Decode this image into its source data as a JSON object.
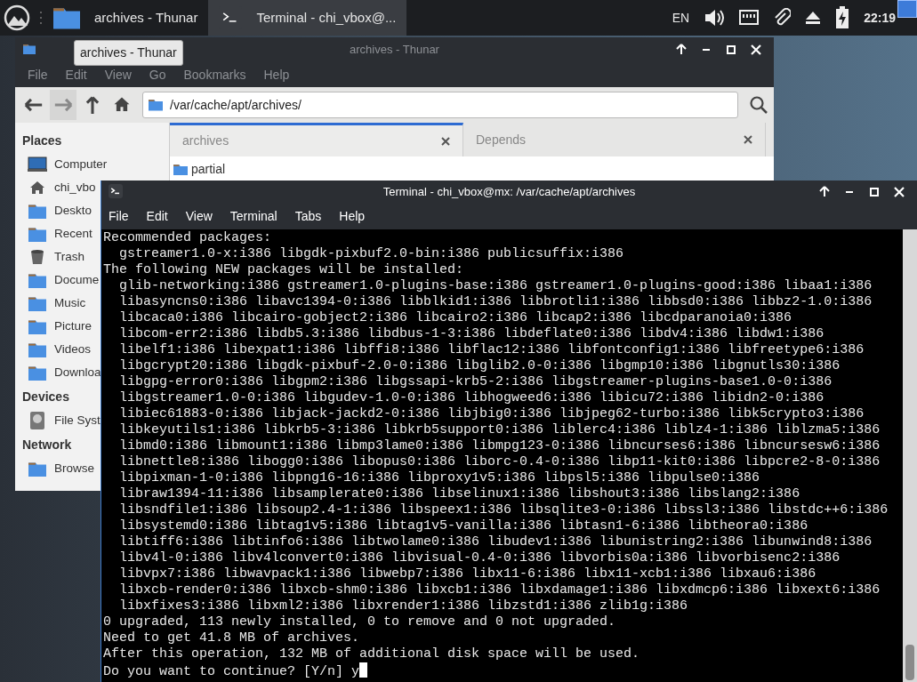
{
  "taskbar": {
    "tasks": [
      {
        "kind": "folder",
        "label": "archives - Thunar",
        "selected": false
      },
      {
        "kind": "terminal",
        "label": "Terminal - chi_vbox@...",
        "selected": true
      }
    ],
    "keyboard_layout": "EN",
    "clock": "22:19"
  },
  "file_manager": {
    "title": "archives - Thunar",
    "tooltip": "archives - Thunar",
    "menu": [
      "File",
      "Edit",
      "View",
      "Go",
      "Bookmarks",
      "Help"
    ],
    "nav": [
      {
        "kind": "back",
        "disabled": false
      },
      {
        "kind": "forward",
        "disabled": true
      },
      {
        "kind": "up",
        "disabled": false
      },
      {
        "kind": "home",
        "disabled": false
      }
    ],
    "location": "/var/cache/apt/archives/",
    "sidebar": [
      {
        "heading": "Places",
        "items": [
          {
            "kind": "computer",
            "label": "Computer"
          },
          {
            "kind": "home",
            "label": "chi_vbo"
          },
          {
            "kind": "folder",
            "label": "Deskto"
          },
          {
            "kind": "folder",
            "label": "Recent"
          },
          {
            "kind": "trash",
            "label": "Trash"
          },
          {
            "kind": "folder",
            "label": "Docume"
          },
          {
            "kind": "folder",
            "label": "Music"
          },
          {
            "kind": "folder",
            "label": "Picture"
          },
          {
            "kind": "folder",
            "label": "Videos"
          },
          {
            "kind": "folder",
            "label": "Downloa"
          }
        ]
      },
      {
        "heading": "Devices",
        "items": [
          {
            "kind": "drive",
            "label": "File Syst"
          }
        ]
      },
      {
        "heading": "Network",
        "items": [
          {
            "kind": "folder",
            "label": "Browse"
          }
        ]
      }
    ],
    "tabs": [
      {
        "label": "archives",
        "selected": true
      },
      {
        "label": "Depends",
        "selected": false
      }
    ],
    "files": [
      "partial"
    ]
  },
  "terminal": {
    "title": "Terminal - chi_vbox@mx: /var/cache/apt/archives",
    "menu": [
      "File",
      "Edit",
      "View",
      "Terminal",
      "Tabs",
      "Help"
    ],
    "lines": [
      "Recommended packages:",
      "  gstreamer1.0-x:i386 libgdk-pixbuf2.0-bin:i386 publicsuffix:i386",
      "The following NEW packages will be installed:",
      "  glib-networking:i386 gstreamer1.0-plugins-base:i386 gstreamer1.0-plugins-good:i386 libaa1:i386",
      "  libasyncns0:i386 libavc1394-0:i386 libblkid1:i386 libbrotli1:i386 libbsd0:i386 libbz2-1.0:i386",
      "  libcaca0:i386 libcairo-gobject2:i386 libcairo2:i386 libcap2:i386 libcdparanoia0:i386",
      "  libcom-err2:i386 libdb5.3:i386 libdbus-1-3:i386 libdeflate0:i386 libdv4:i386 libdw1:i386",
      "  libelf1:i386 libexpat1:i386 libffi8:i386 libflac12:i386 libfontconfig1:i386 libfreetype6:i386",
      "  libgcrypt20:i386 libgdk-pixbuf-2.0-0:i386 libglib2.0-0:i386 libgmp10:i386 libgnutls30:i386",
      "  libgpg-error0:i386 libgpm2:i386 libgssapi-krb5-2:i386 libgstreamer-plugins-base1.0-0:i386",
      "  libgstreamer1.0-0:i386 libgudev-1.0-0:i386 libhogweed6:i386 libicu72:i386 libidn2-0:i386",
      "  libiec61883-0:i386 libjack-jackd2-0:i386 libjbig0:i386 libjpeg62-turbo:i386 libk5crypto3:i386",
      "  libkeyutils1:i386 libkrb5-3:i386 libkrb5support0:i386 liblerc4:i386 liblz4-1:i386 liblzma5:i386",
      "  libmd0:i386 libmount1:i386 libmp3lame0:i386 libmpg123-0:i386 libncurses6:i386 libncursesw6:i386",
      "  libnettle8:i386 libogg0:i386 libopus0:i386 liborc-0.4-0:i386 libp11-kit0:i386 libpcre2-8-0:i386",
      "  libpixman-1-0:i386 libpng16-16:i386 libproxy1v5:i386 libpsl5:i386 libpulse0:i386",
      "  libraw1394-11:i386 libsamplerate0:i386 libselinux1:i386 libshout3:i386 libslang2:i386",
      "  libsndfile1:i386 libsoup2.4-1:i386 libspeex1:i386 libsqlite3-0:i386 libssl3:i386 libstdc++6:i386",
      "  libsystemd0:i386 libtag1v5:i386 libtag1v5-vanilla:i386 libtasn1-6:i386 libtheora0:i386",
      "  libtiff6:i386 libtinfo6:i386 libtwolame0:i386 libudev1:i386 libunistring2:i386 libunwind8:i386",
      "  libv4l-0:i386 libv4lconvert0:i386 libvisual-0.4-0:i386 libvorbis0a:i386 libvorbisenc2:i386",
      "  libvpx7:i386 libwavpack1:i386 libwebp7:i386 libx11-6:i386 libx11-xcb1:i386 libxau6:i386",
      "  libxcb-render0:i386 libxcb-shm0:i386 libxcb1:i386 libxdamage1:i386 libxdmcp6:i386 libxext6:i386",
      "  libxfixes3:i386 libxml2:i386 libxrender1:i386 libzstd1:i386 zlib1g:i386",
      "0 upgraded, 113 newly installed, 0 to remove and 0 not upgraded.",
      "Need to get 41.8 MB of archives.",
      "After this operation, 132 MB of additional disk space will be used.",
      "Do you want to continue? [Y/n] y"
    ],
    "cursor": true
  }
}
